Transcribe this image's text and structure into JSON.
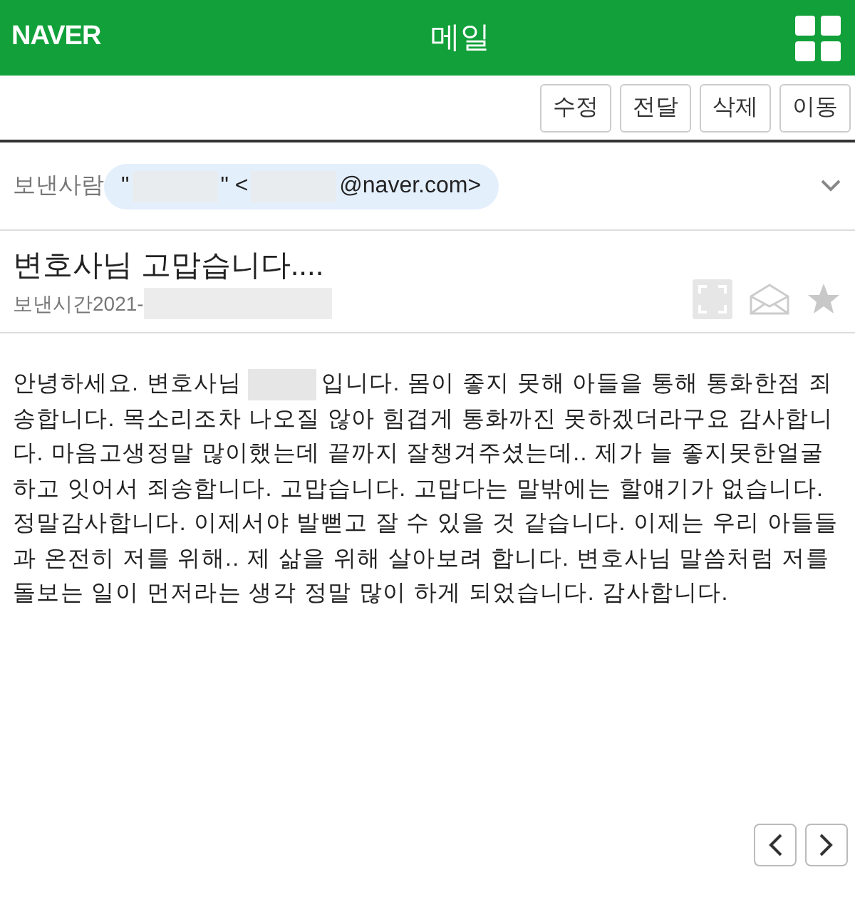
{
  "header": {
    "logo": "NAVER",
    "title": "메일"
  },
  "toolbar": [
    "수정",
    "전달",
    "삭제",
    "이동"
  ],
  "sender": {
    "label": "보낸사람",
    "parts": [
      {
        "kind": "text",
        "text": "\""
      },
      {
        "kind": "redacted"
      },
      {
        "kind": "text",
        "text": "\" <"
      },
      {
        "kind": "redacted"
      },
      {
        "kind": "text",
        "text": "@naver.com>"
      }
    ]
  },
  "subject": "변호사님 고맙습니다....",
  "sent_time": {
    "label": "보낸시간2021-",
    "parts": [
      {
        "kind": "redacted"
      }
    ]
  },
  "starred": false,
  "body": {
    "parts": [
      {
        "kind": "text",
        "text": "안녕하세요. 변호사님"
      },
      {
        "kind": "redacted"
      },
      {
        "kind": "text",
        "text": "입니다. 몸이 좋지 못해 아들을 통해 통화한점 죄송합니다. 목소리조차 나오질 않아 힘겹게 통화까진 못하겠더라구요 감사합니다. 마음고생정말 많이했는데 끝까지 잘챙겨주셨는데.. 제가 늘 좋지못한얼굴 하고 잇어서 죄송합니다. 고맙습니다. 고맙다는 말밖에는 할얘기가 없습니다. 정말감사합니다. 이제서야 발뻗고 잘 수 있을 것 같습니다. 이제는 우리 아들들과 온전히 저를 위해.. 제 삶을 위해 살아보려 합니다. 변호사님 말씀처럼 저를 돌보는 일이 먼저라는 생각 정말 많이 하게 되었습니다. 감사합니다."
      }
    ]
  }
}
